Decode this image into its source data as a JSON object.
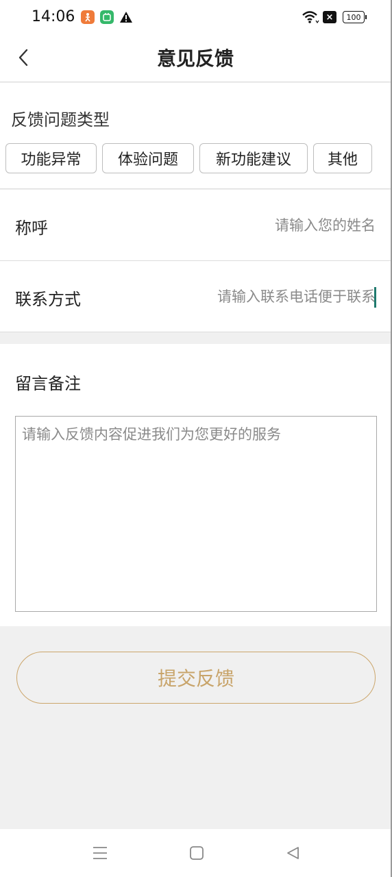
{
  "status_bar": {
    "time": "14:06",
    "battery": "100",
    "app_icons": [
      "fitness-app-icon",
      "green-app-icon",
      "warning-icon"
    ],
    "close_glyph": "×"
  },
  "header": {
    "title": "意见反馈",
    "back_icon": "chevron-left-icon"
  },
  "feedback_type": {
    "label": "反馈问题类型",
    "options": [
      "功能异常",
      "体验问题",
      "新功能建议",
      "其他"
    ]
  },
  "name_field": {
    "label": "称呼",
    "placeholder": "请输入您的姓名",
    "value": ""
  },
  "contact_field": {
    "label": "联系方式",
    "placeholder": "请输入联系电话便于联系",
    "value": ""
  },
  "remark": {
    "label": "留言备注",
    "placeholder": "请输入反馈内容促进我们为您更好的服务",
    "value": ""
  },
  "submit": {
    "label": "提交反馈"
  },
  "colors": {
    "accent_gold": "#c8a46a",
    "caret_teal": "#1f7a6e",
    "background_gray": "#f0f0f0"
  },
  "nav_bar": {
    "icons": [
      "menu-icon",
      "home-square-icon",
      "back-triangle-icon"
    ]
  }
}
